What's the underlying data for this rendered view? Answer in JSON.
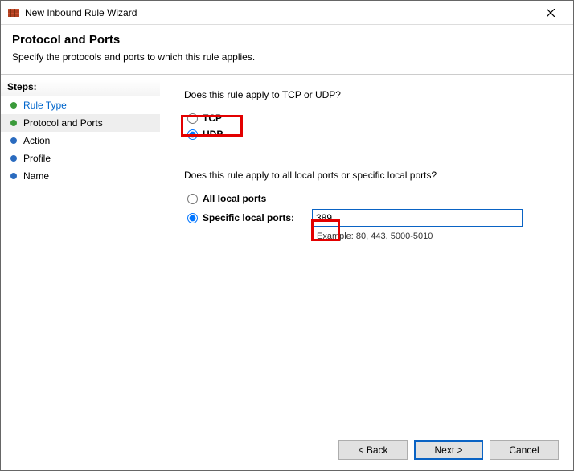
{
  "window": {
    "title": "New Inbound Rule Wizard"
  },
  "header": {
    "title": "Protocol and Ports",
    "description": "Specify the protocols and ports to which this rule applies."
  },
  "sidebar": {
    "heading": "Steps:",
    "items": [
      {
        "label": "Rule Type"
      },
      {
        "label": "Protocol and Ports"
      },
      {
        "label": "Action"
      },
      {
        "label": "Profile"
      },
      {
        "label": "Name"
      }
    ]
  },
  "main": {
    "question1": "Does this rule apply to TCP or UDP?",
    "option_tcp": "TCP",
    "option_udp": "UDP",
    "question2": "Does this rule apply to all local ports or specific local ports?",
    "option_all_ports": "All local ports",
    "option_specific_ports": "Specific local ports:",
    "port_value": "389",
    "example_text": "Example: 80, 443, 5000-5010"
  },
  "footer": {
    "back": "< Back",
    "next": "Next >",
    "cancel": "Cancel"
  }
}
